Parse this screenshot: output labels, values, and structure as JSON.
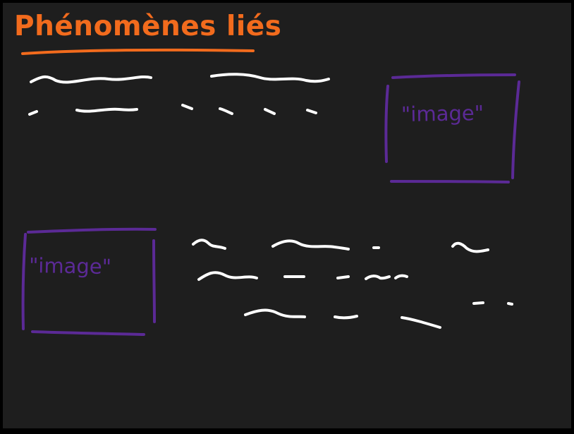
{
  "slide": {
    "title": "Phénomènes liés",
    "image_placeholder_top_right": "\"image\"",
    "image_placeholder_bottom_left": "\"image\""
  },
  "colors": {
    "background": "#1e1e1e",
    "border": "#000000",
    "title": "#f26b1d",
    "scribble": "#ffffff",
    "placeholder": "#5b2a96"
  }
}
